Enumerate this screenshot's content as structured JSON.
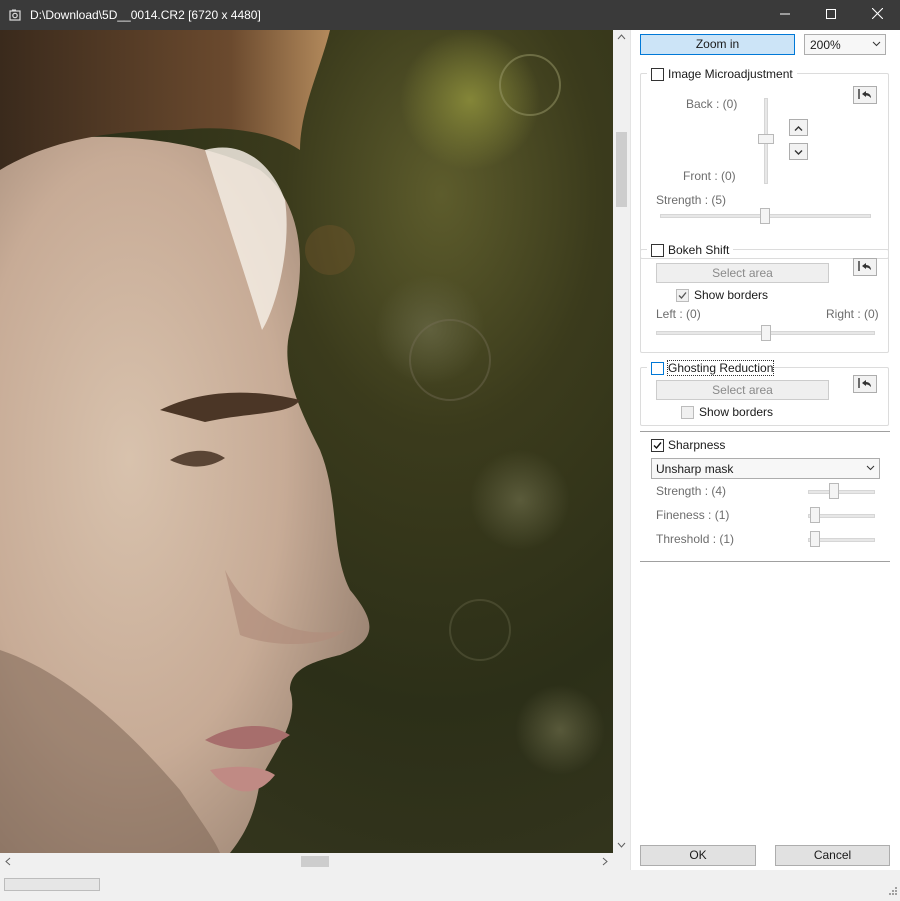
{
  "window": {
    "title": "D:\\Download\\5D__0014.CR2 [6720 x 4480]"
  },
  "toolbar": {
    "zoom_in_label": "Zoom in",
    "zoom_level": "200%"
  },
  "microadjustment": {
    "label": "Image Microadjustment",
    "checked": false,
    "back_label": "Back : (0)",
    "front_label": "Front : (0)",
    "strength_label": "Strength : (5)",
    "strength_value": 5
  },
  "bokeh_shift": {
    "label": "Bokeh Shift",
    "checked": false,
    "select_area_label": "Select area",
    "show_borders_label": "Show borders",
    "show_borders_checked": true,
    "left_label": "Left : (0)",
    "right_label": "Right : (0)"
  },
  "ghosting": {
    "label": "Ghosting Reduction",
    "checked": false,
    "select_area_label": "Select area",
    "show_borders_label": "Show borders",
    "show_borders_checked": false
  },
  "sharpness": {
    "label": "Sharpness",
    "checked": true,
    "method": "Unsharp mask",
    "strength_label": "Strength : (4)",
    "fineness_label": "Fineness : (1)",
    "threshold_label": "Threshold : (1)"
  },
  "dialog": {
    "ok_label": "OK",
    "cancel_label": "Cancel"
  },
  "icons": {
    "app": "app-icon",
    "minimize": "minimize-icon",
    "maximize": "maximize-icon",
    "close": "close-icon",
    "reset": "reset-icon",
    "up": "chevron-up-icon",
    "down": "chevron-down-icon"
  }
}
